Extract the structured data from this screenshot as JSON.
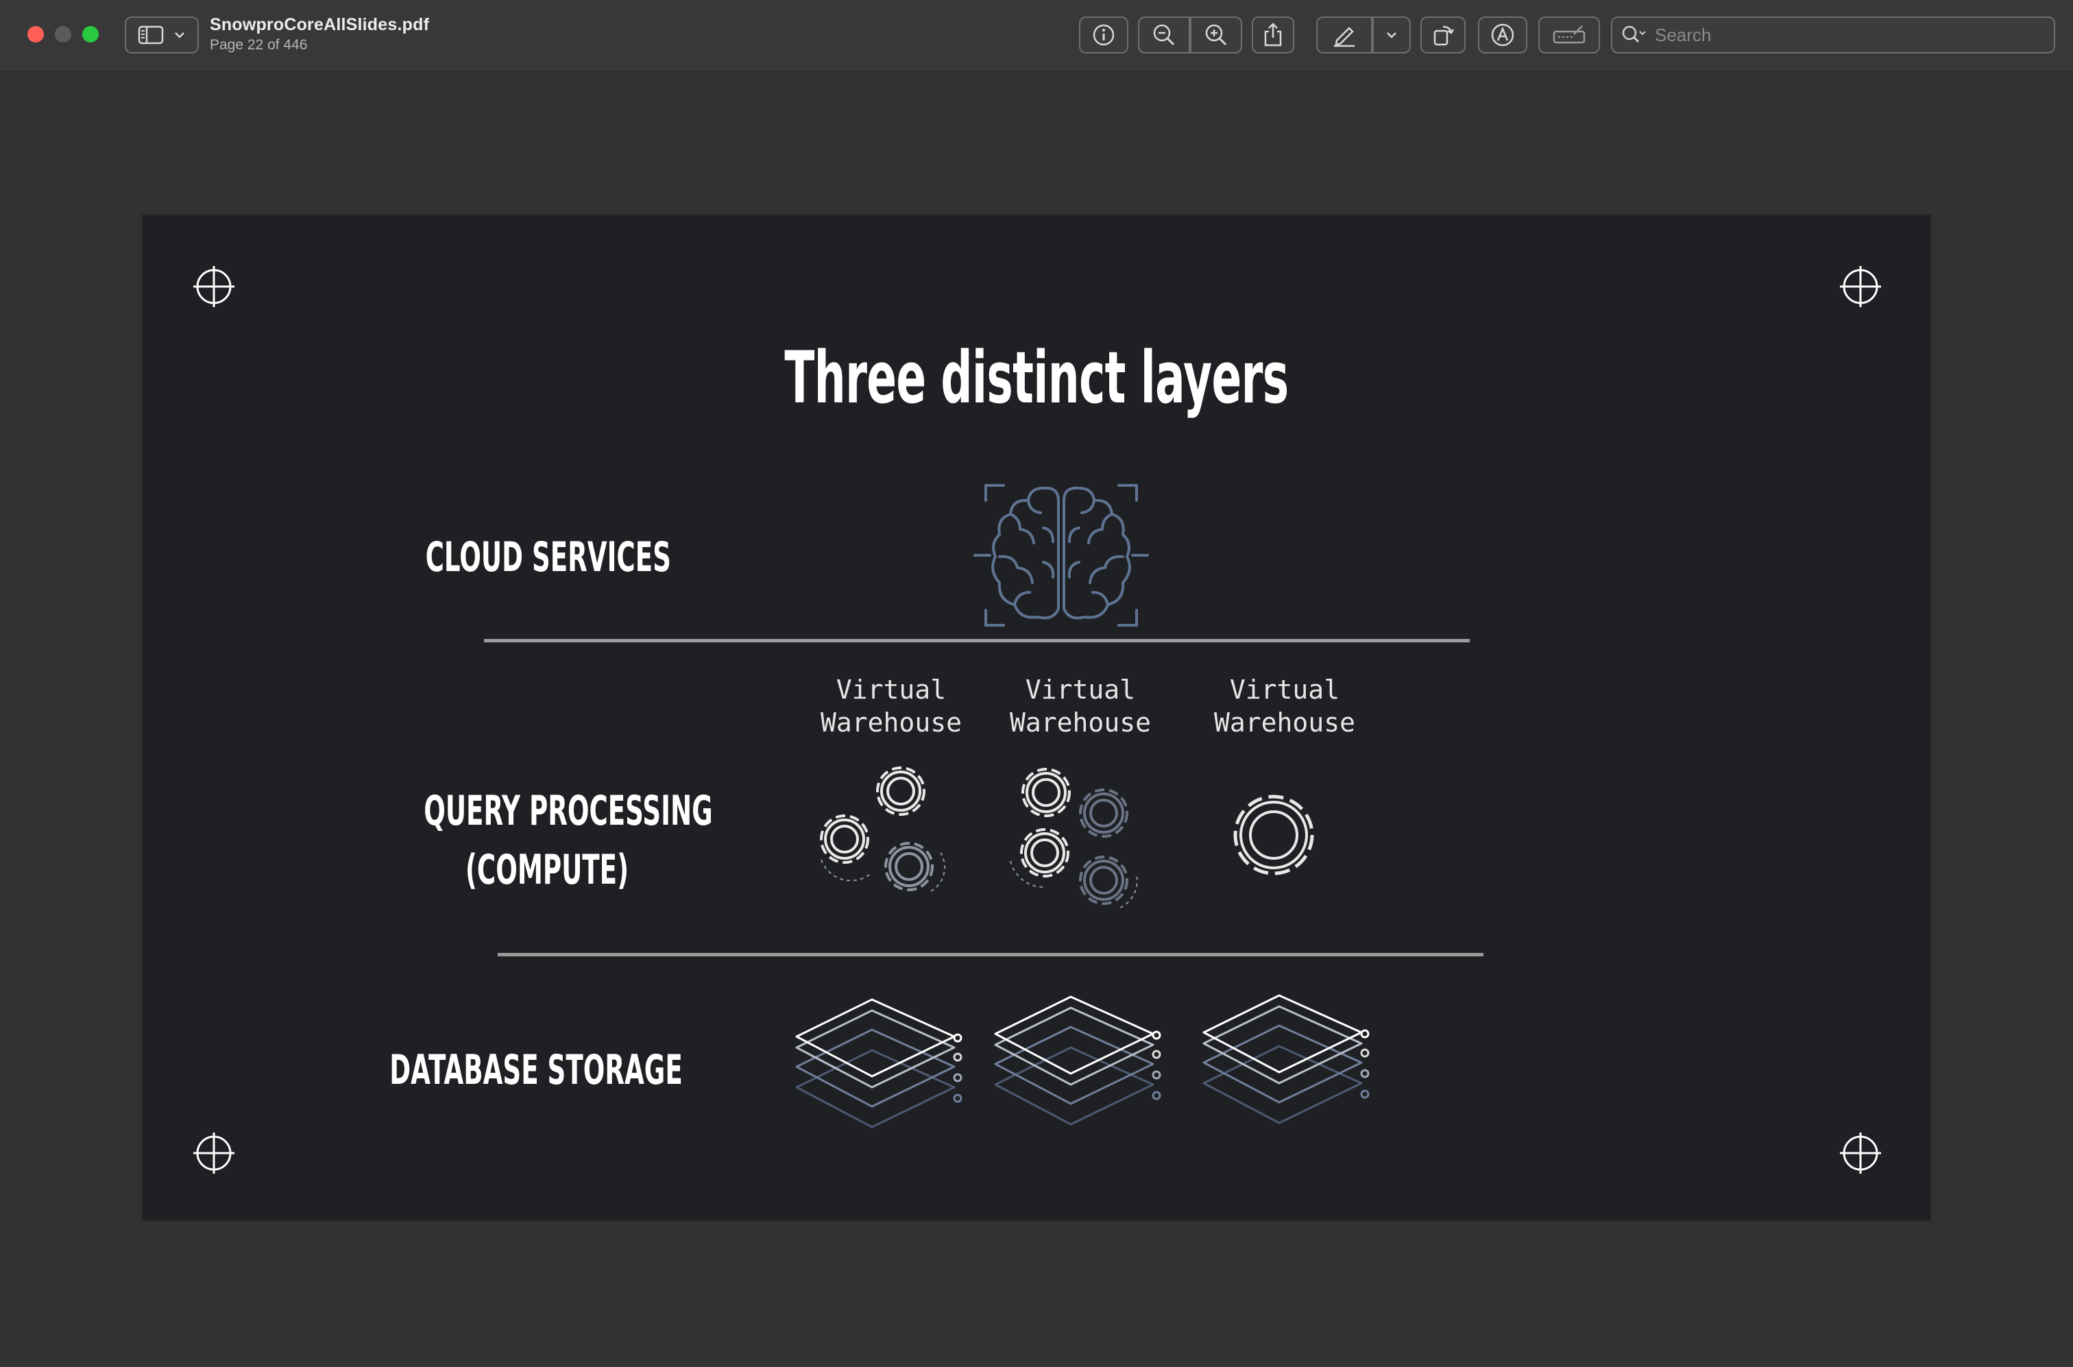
{
  "window": {
    "file_name": "SnowproCoreAllSlides.pdf",
    "page_status": "Page 22 of 446"
  },
  "toolbar": {
    "buttons": [
      "sidebar-toggle",
      "info",
      "zoom-out",
      "zoom-in",
      "share",
      "markup",
      "markup-options",
      "rotate",
      "annotate",
      "form-fill"
    ]
  },
  "search": {
    "placeholder": "Search",
    "value": ""
  },
  "slide": {
    "title": "Three distinct layers",
    "layers": {
      "cloud_services": "CLOUD SERVICES",
      "query_processing_line1": "QUERY PROCESSING",
      "query_processing_line2": "(COMPUTE)",
      "database_storage": "DATABASE STORAGE"
    },
    "warehouses": [
      {
        "line1": "Virtual",
        "line2": "Warehouse"
      },
      {
        "line1": "Virtual",
        "line2": "Warehouse"
      },
      {
        "line1": "Virtual",
        "line2": "Warehouse"
      }
    ]
  },
  "colors": {
    "slide_background": "#1f2024",
    "icon_stroke": "#e8e8e8",
    "icon_accent": "#5e7391",
    "divider": "#9c9c9c"
  }
}
